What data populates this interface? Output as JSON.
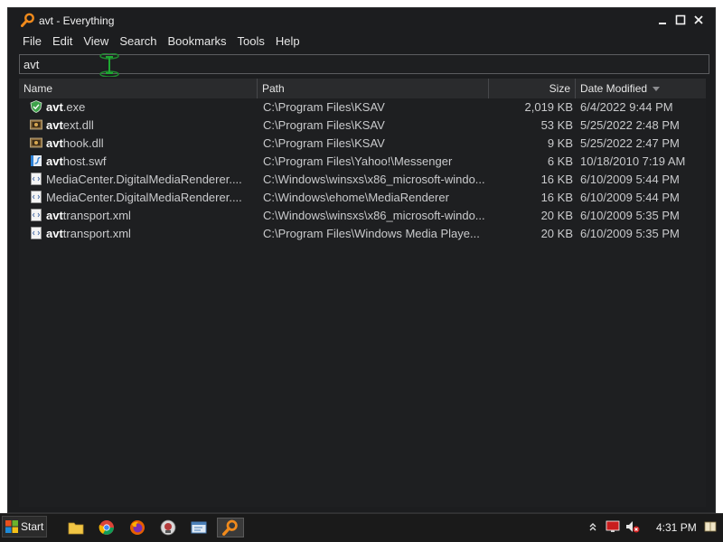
{
  "window": {
    "title": "avt - Everything"
  },
  "menu": [
    "File",
    "Edit",
    "View",
    "Search",
    "Bookmarks",
    "Tools",
    "Help"
  ],
  "search": {
    "value": "avt"
  },
  "columns": {
    "name": "Name",
    "path": "Path",
    "size": "Size",
    "date": "Date Modified"
  },
  "rows": [
    {
      "icon": "shield-app-icon",
      "name_match": "avt",
      "name_rest": ".exe",
      "path": "C:\\Program Files\\KSAV",
      "size": "2,019 KB",
      "date": "6/4/2022 9:44 PM"
    },
    {
      "icon": "dll-icon",
      "name_match": "avt",
      "name_rest": "ext.dll",
      "path": "C:\\Program Files\\KSAV",
      "size": "53 KB",
      "date": "5/25/2022 2:48 PM"
    },
    {
      "icon": "dll-icon",
      "name_match": "avt",
      "name_rest": "hook.dll",
      "path": "C:\\Program Files\\KSAV",
      "size": "9 KB",
      "date": "5/25/2022 2:47 PM"
    },
    {
      "icon": "swf-icon",
      "name_match": "avt",
      "name_rest": "host.swf",
      "path": "C:\\Program Files\\Yahoo!\\Messenger",
      "size": "6 KB",
      "date": "10/18/2010 7:19 AM"
    },
    {
      "icon": "xml-icon",
      "name_match": "",
      "name_rest": "MediaCenter.DigitalMediaRenderer....",
      "path": "C:\\Windows\\winsxs\\x86_microsoft-windo...",
      "size": "16 KB",
      "date": "6/10/2009 5:44 PM"
    },
    {
      "icon": "xml-icon",
      "name_match": "",
      "name_rest": "MediaCenter.DigitalMediaRenderer....",
      "path": "C:\\Windows\\ehome\\MediaRenderer",
      "size": "16 KB",
      "date": "6/10/2009 5:44 PM"
    },
    {
      "icon": "xml-icon",
      "name_match": "avt",
      "name_rest": "transport.xml",
      "path": "C:\\Windows\\winsxs\\x86_microsoft-windo...",
      "size": "20 KB",
      "date": "6/10/2009 5:35 PM"
    },
    {
      "icon": "xml-icon",
      "name_match": "avt",
      "name_rest": "transport.xml",
      "path": "C:\\Program Files\\Windows Media Playe...",
      "size": "20 KB",
      "date": "6/10/2009 5:35 PM"
    }
  ],
  "taskbar": {
    "start_label": "Start",
    "pinned": [
      "explorer-folder-icon",
      "chrome-icon",
      "firefox-icon",
      "app-icon",
      "window-icon",
      "everything-search-icon"
    ],
    "clock": "4:31 PM"
  },
  "colors": {
    "window_bg": "#1c1d1f",
    "accent_orange": "#f08a1c"
  }
}
